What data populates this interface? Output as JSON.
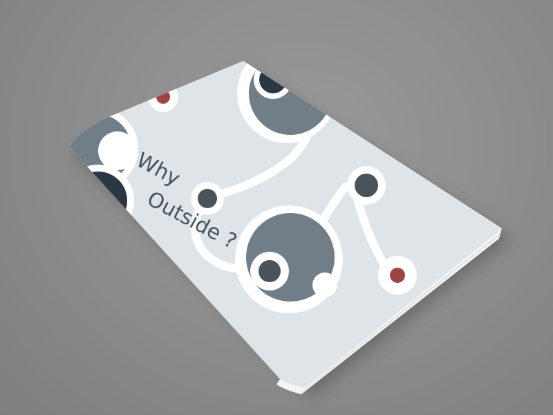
{
  "cover": {
    "title_line1": "Why",
    "title_line2": "Outside ?"
  },
  "colors": {
    "background": "#8d8d8d",
    "cover": "#dde3e7",
    "dark_navy": "#1f2d38",
    "slate": "#6a7882",
    "dark_gray": "#3f4a52",
    "accent_red": "#9a3a3a",
    "white": "#ffffff"
  }
}
